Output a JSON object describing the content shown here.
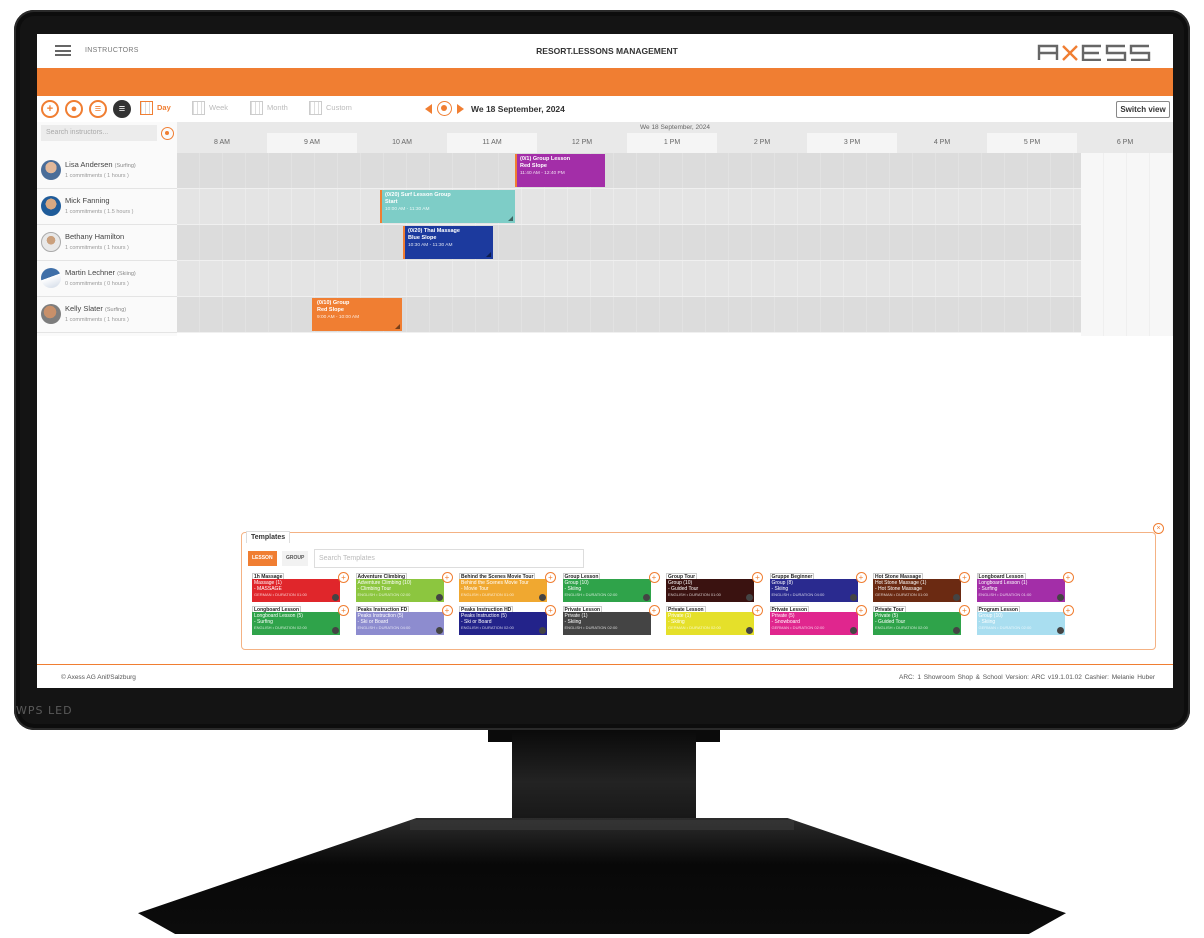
{
  "header": {
    "section": "INSTRUCTORS",
    "title": "RESORT.LESSONS MANAGEMENT",
    "logo_text": "AXESS"
  },
  "toolbar": {
    "views": [
      "Day",
      "Week",
      "Month",
      "Custom"
    ],
    "date_title": "We 18 September, 2024",
    "switch_label": "Switch view"
  },
  "schedule": {
    "search_placeholder": "Search instructors...",
    "date_band": "We 18 September, 2024",
    "hours": [
      "8 AM",
      "9 AM",
      "10 AM",
      "11 AM",
      "12 PM",
      "1 PM",
      "2 PM",
      "3 PM",
      "4 PM",
      "5 PM",
      "6 PM"
    ],
    "instructors": [
      {
        "name": "Lisa Andersen",
        "sport": "(Surfing)",
        "commitments": "1 commitments ( 1 hours )"
      },
      {
        "name": "Mick Fanning",
        "sport": "",
        "commitments": "1 commitments ( 1.5 hours )"
      },
      {
        "name": "Bethany Hamilton",
        "sport": "",
        "commitments": "1 commitments ( 1 hours )"
      },
      {
        "name": "Martin Lechner",
        "sport": "(Skiing)",
        "commitments": "0 commitments ( 0 hours )"
      },
      {
        "name": "Kelly Slater",
        "sport": "(Surfing)",
        "commitments": "1 commitments ( 1 hours )"
      }
    ],
    "events": [
      {
        "title": "(0/1) Group Lesson",
        "sub": "Red Slope",
        "time": "11:40 AM - 12:40 PM",
        "color": "#a32ea8"
      },
      {
        "title": "(0/20) Surf Lesson Group",
        "sub": "Start",
        "time": "10:00 AM - 11:30 AM",
        "color": "#7ecdc7"
      },
      {
        "title": "(0/20) Thai Massage",
        "sub": "Blue Slope",
        "time": "10:30 AM - 11:30 AM",
        "color": "#1c3a9e"
      },
      {
        "title": "(0/10) Group",
        "sub": "Red Slope",
        "time": "9:00 AM - 10:00 AM",
        "color": "#f07e32"
      }
    ]
  },
  "templates": {
    "tab": "Templates",
    "filters": [
      "LESSON",
      "GROUP"
    ],
    "search_placeholder": "Search Templates",
    "cards": [
      {
        "title": "1h Massage",
        "line1": "Massage (1)",
        "line2": "- MASSAGE",
        "meta": "GERMAN • DURATION 01:00",
        "color": "#e0262b"
      },
      {
        "title": "Adventure Climbing",
        "line1": "Adventure Climbing (10)",
        "line2": "- Climbing Tour",
        "meta": "ENGLISH • DURATION 02:00",
        "color": "#8cc63f"
      },
      {
        "title": "Behind the Scenes Movie Tour",
        "line1": "Behind the Scenes Movie Tour",
        "line2": "- Movie Tour",
        "meta": "ENGLISH • DURATION 01:00",
        "color": "#f0a830"
      },
      {
        "title": "Group Lesson",
        "line1": "Group (10)",
        "line2": "- Skiing",
        "meta": "ENGLISH • DURATION 02:00",
        "color": "#2fa34a"
      },
      {
        "title": "Group Tour",
        "line1": "Group (10)",
        "line2": "- Guided Tour",
        "meta": "ENGLISH • DURATION 01:00",
        "color": "#3a1210"
      },
      {
        "title": "Gruppe Beginner",
        "line1": "Group (8)",
        "line2": "- Skiing",
        "meta": "ENGLISH • DURATION 04:00",
        "color": "#2a2a8f"
      },
      {
        "title": "Hot Stone Massage",
        "line1": "Hot Stone Massage (1)",
        "line2": "- Hot Stone Massage",
        "meta": "GERMAN • DURATION 01:00",
        "color": "#6b2a12"
      },
      {
        "title": "Longboard Lesson",
        "line1": "Longboard Lesson (1)",
        "line2": "- Surfing",
        "meta": "ENGLISH • DURATION 01:00",
        "color": "#a32ea8"
      },
      {
        "title": "Longboard Lesson",
        "line1": "Longboard Lesson (5)",
        "line2": "- Surfing",
        "meta": "ENGLISH • DURATION 02:00",
        "color": "#2fa34a"
      },
      {
        "title": "Peaks Instruction FD",
        "line1": "Peaks Instruction (5)",
        "line2": "- Ski or Board",
        "meta": "ENGLISH • DURATION 04:00",
        "color": "#8d8ccf"
      },
      {
        "title": "Peaks Instruction HD",
        "line1": "Peaks Instruction (5)",
        "line2": "- Ski or Board",
        "meta": "ENGLISH • DURATION 02:00",
        "color": "#23238a"
      },
      {
        "title": "Private Lesson",
        "line1": "Private (1)",
        "line2": "- Skiing",
        "meta": "ENGLISH • DURATION 02:00",
        "color": "#444444"
      },
      {
        "title": "Private Lesson",
        "line1": "Private (1)",
        "line2": "- Skiing",
        "meta": "GERMAN • DURATION 02:00",
        "color": "#e5e02a"
      },
      {
        "title": "Private Lesson",
        "line1": "Private (5)",
        "line2": "- Snowboard",
        "meta": "GERMAN • DURATION 02:00",
        "color": "#e0268e"
      },
      {
        "title": "Private Tour",
        "line1": "Private (5)",
        "line2": "- Guided Tour",
        "meta": "ENGLISH • DURATION 02:00",
        "color": "#2fa34a"
      },
      {
        "title": "Program Lesson",
        "line1": "Group (10)",
        "line2": "- Skiing",
        "meta": "GERMAN • DURATION 02:00",
        "color": "#a9def0"
      }
    ]
  },
  "footer": {
    "left": "© Axess AG Anif/Salzburg",
    "right": "ARC: 1   Showroom Shop & School   Version: ARC v19.1.01.02   Cashier: Melanie Huber"
  },
  "monitor_brand": "WPS LED"
}
